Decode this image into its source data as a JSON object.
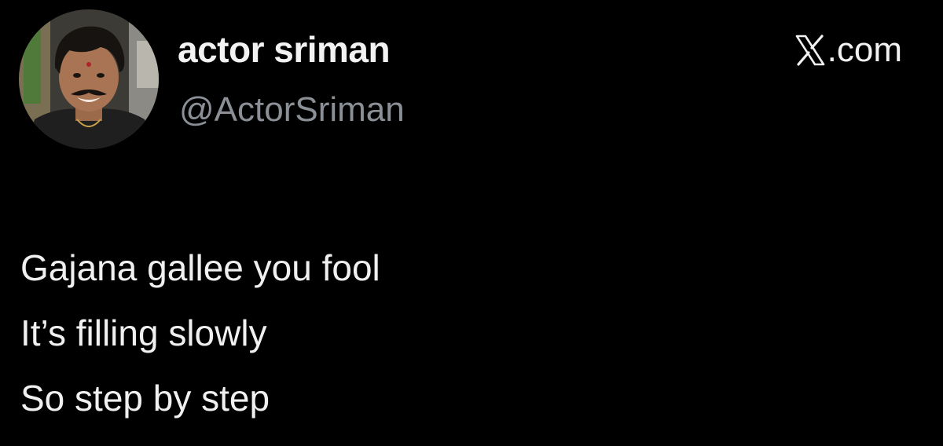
{
  "user": {
    "display_name": "actor sriman",
    "handle": "@ActorSriman",
    "avatar_icon": "profile-photo"
  },
  "site": {
    "icon": "x-logo-icon",
    "label": ".com"
  },
  "tweet": {
    "lines": [
      "Gajana gallee you fool",
      "It’s filling slowly",
      "So step by step"
    ]
  },
  "colors": {
    "background": "#000000",
    "primary_text": "#f2f2f2",
    "secondary_text": "#8b9096"
  }
}
